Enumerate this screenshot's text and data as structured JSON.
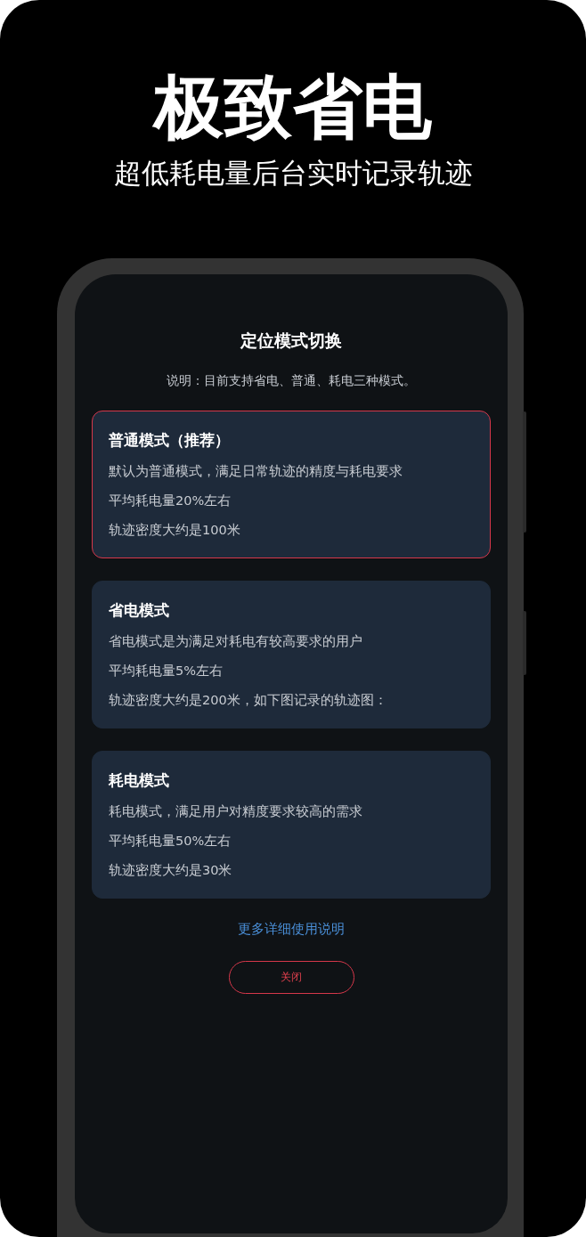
{
  "headline": "极致省电",
  "subtitle": "超低耗电量后台实时记录轨迹",
  "dialog": {
    "title": "定位模式切换",
    "description": "说明：目前支持省电、普通、耗电三种模式。",
    "modes": [
      {
        "title": "普通模式（推荐）",
        "selected": true,
        "lines": [
          "默认为普通模式，满足日常轨迹的精度与耗电要求",
          "平均耗电量20%左右",
          "轨迹密度大约是100米"
        ]
      },
      {
        "title": "省电模式",
        "selected": false,
        "lines": [
          "省电模式是为满足对耗电有较高要求的用户",
          "平均耗电量5%左右",
          "轨迹密度大约是200米，如下图记录的轨迹图："
        ]
      },
      {
        "title": "耗电模式",
        "selected": false,
        "lines": [
          "耗电模式，满足用户对精度要求较高的需求",
          "平均耗电量50%左右",
          "轨迹密度大约是30米"
        ]
      }
    ],
    "link": "更多详细使用说明",
    "close_button": "关闭"
  }
}
